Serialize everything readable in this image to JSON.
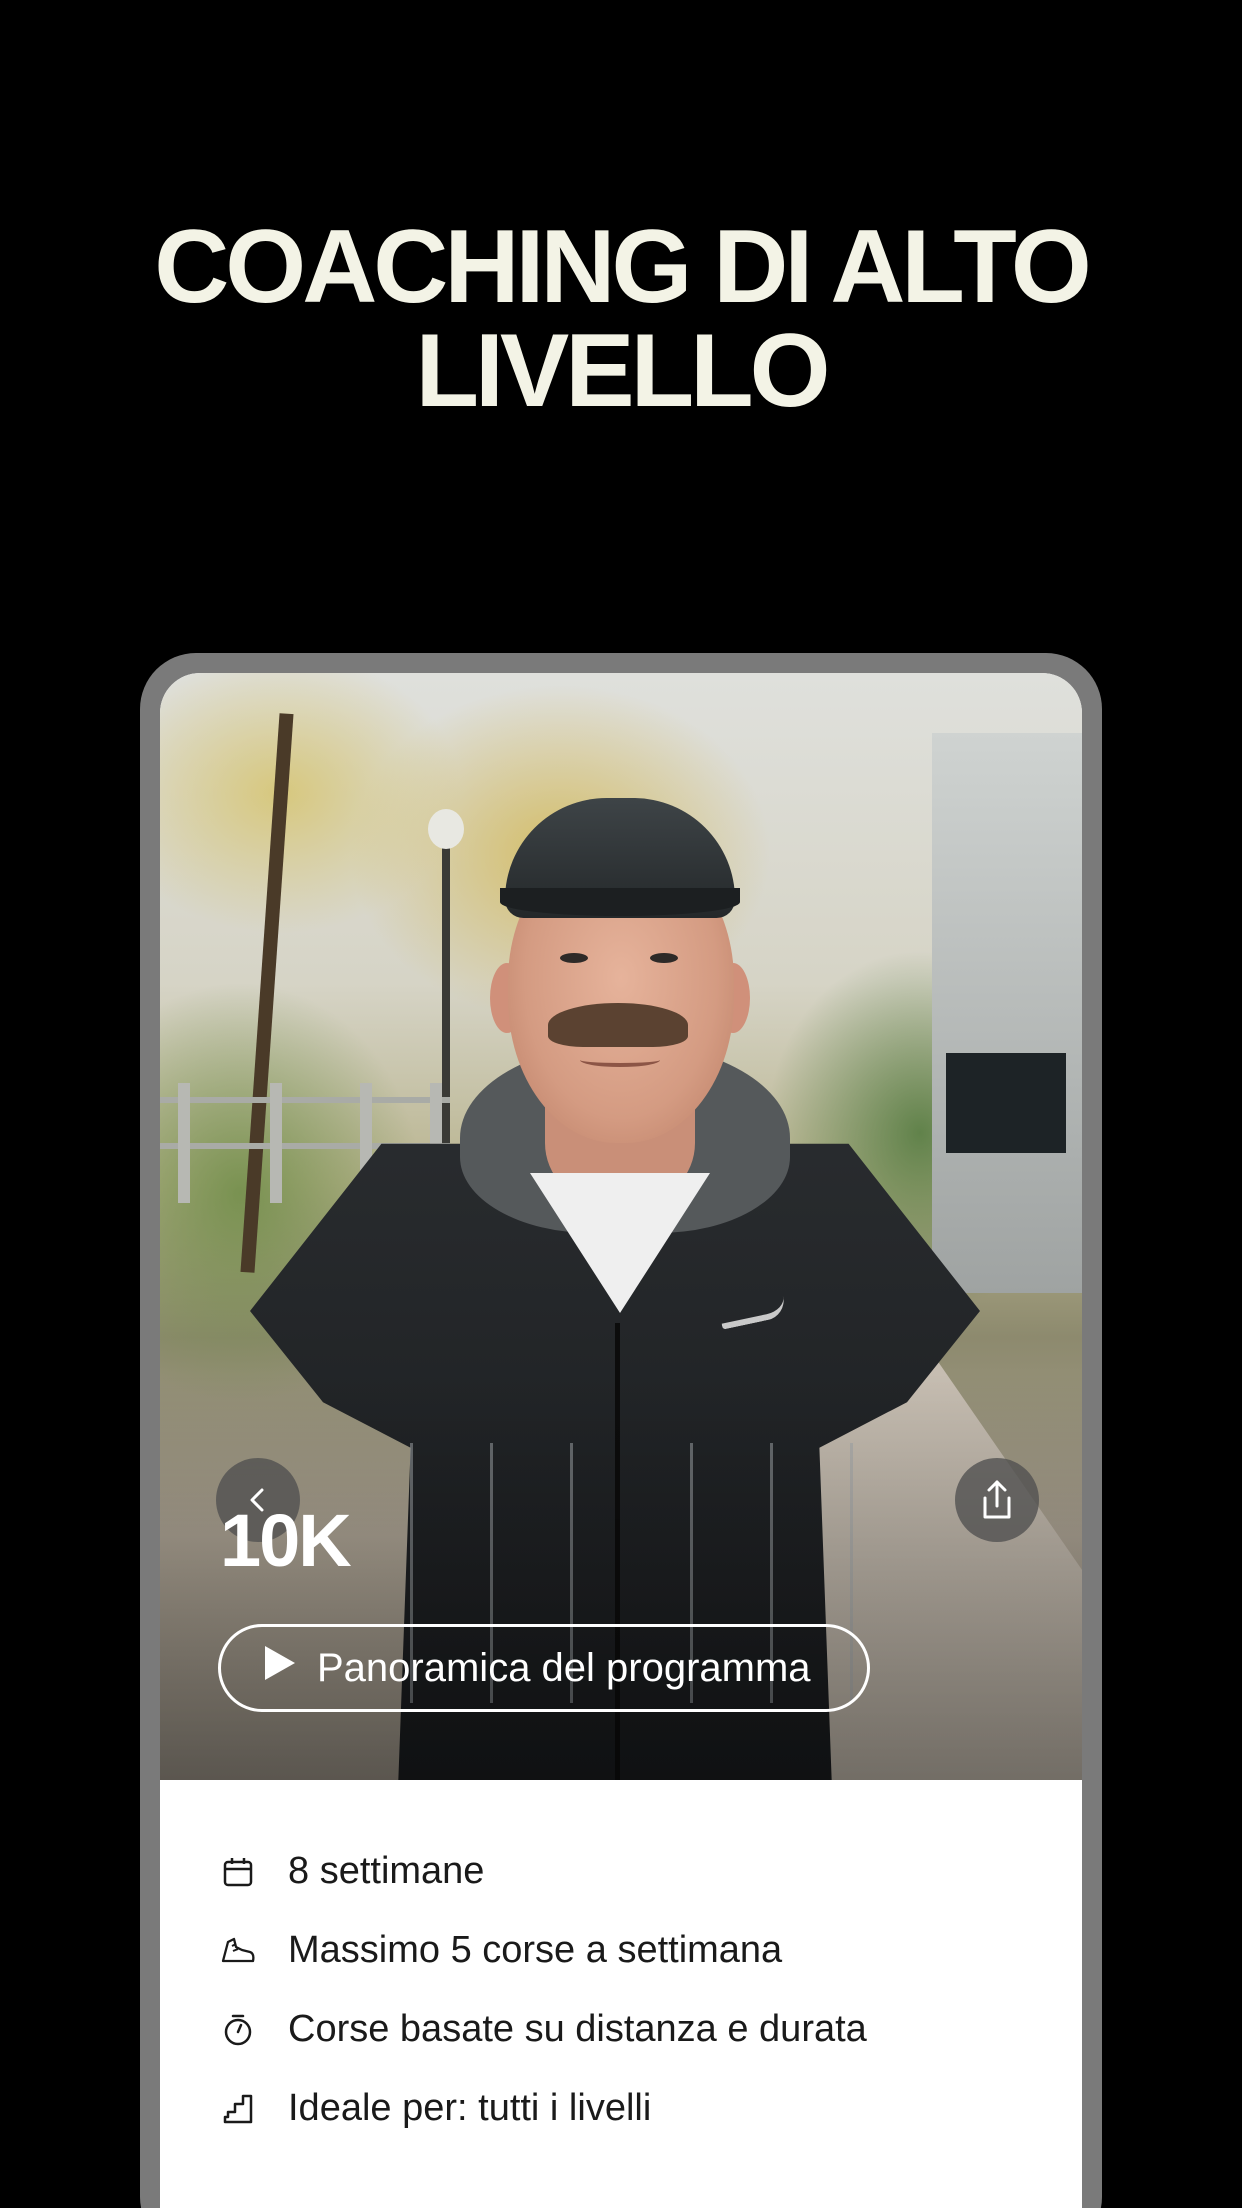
{
  "headline": {
    "line1": "COACHING DI ALTO",
    "line2": "LIVELLO"
  },
  "program": {
    "title": "10K",
    "overview_button_label": "Panoramica del programma"
  },
  "details": [
    {
      "icon": "calendar-icon",
      "text": "8 settimane"
    },
    {
      "icon": "running-shoe-icon",
      "text": "Massimo 5 corse a settimana"
    },
    {
      "icon": "stopwatch-icon",
      "text": "Corse basate su distanza e durata"
    },
    {
      "icon": "stairs-level-icon",
      "text": "Ideale per: tutti i livelli"
    }
  ],
  "icons": {
    "back": "chevron-left-icon",
    "share": "share-icon",
    "play": "play-icon"
  },
  "colors": {
    "background": "#000000",
    "headline": "#f3f3e6",
    "frame": "#7a7a7a",
    "details_text": "#1a1a1a"
  }
}
